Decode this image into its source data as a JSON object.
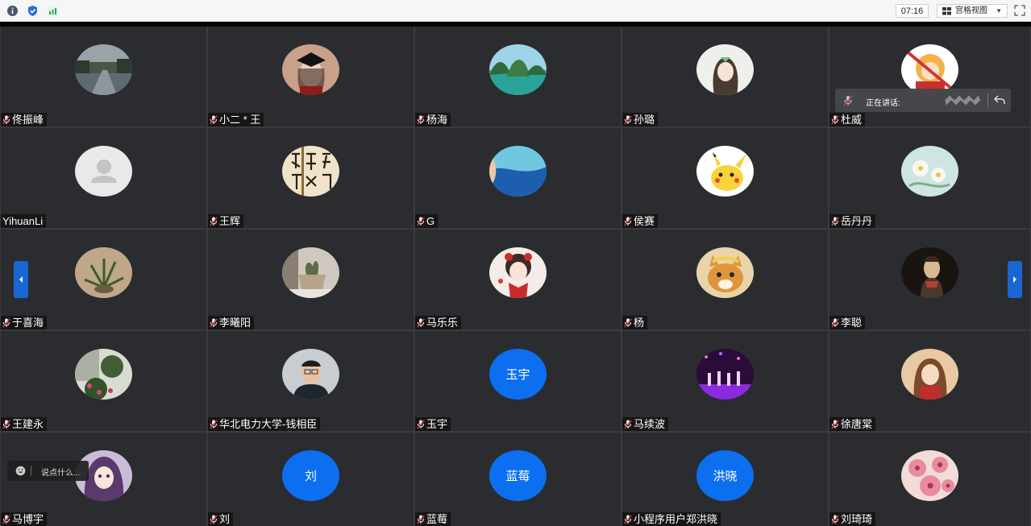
{
  "toolbar": {
    "icons": [
      "info-icon",
      "shield-icon",
      "signal-icon"
    ],
    "timer": "07:16",
    "view_mode": "宫格视图",
    "colors": {
      "info": "#4a5568",
      "shield": "#2b6fd6",
      "signal": "#29a745"
    }
  },
  "speaking": {
    "label": "正在讲话:"
  },
  "chat": {
    "placeholder": "说点什么..."
  },
  "participants": [
    {
      "name": "佟振峰",
      "muted": true,
      "avatar": "photo-river"
    },
    {
      "name": "小二 * 王",
      "muted": true,
      "avatar": "photo-graduate"
    },
    {
      "name": "杨海",
      "muted": true,
      "avatar": "photo-islands"
    },
    {
      "name": "孙璐",
      "muted": true,
      "avatar": "photo-girl-sketch"
    },
    {
      "name": "杜威",
      "muted": true,
      "avatar": "photo-cartoon-monkey"
    },
    {
      "name": "YihuanLi",
      "muted": false,
      "avatar": "default-user"
    },
    {
      "name": "王辉",
      "muted": true,
      "avatar": "photo-calligraphy"
    },
    {
      "name": "G",
      "muted": true,
      "avatar": "photo-sea"
    },
    {
      "name": "侯赛",
      "muted": true,
      "avatar": "photo-pikachu"
    },
    {
      "name": "岳丹丹",
      "muted": true,
      "avatar": "photo-flowers-pale"
    },
    {
      "name": "于喜海",
      "muted": true,
      "avatar": "photo-plant"
    },
    {
      "name": "李曦阳",
      "muted": true,
      "avatar": "photo-pot"
    },
    {
      "name": "马乐乐",
      "muted": true,
      "avatar": "photo-girl-red"
    },
    {
      "name": "杨",
      "muted": true,
      "avatar": "photo-cat"
    },
    {
      "name": "李聪",
      "muted": true,
      "avatar": "photo-painting"
    },
    {
      "name": "王建永",
      "muted": true,
      "avatar": "photo-garden"
    },
    {
      "name": "华北电力大学-钱相臣",
      "muted": true,
      "avatar": "photo-man"
    },
    {
      "name": "玉宇",
      "muted": true,
      "avatar": "text",
      "avatar_text": "玉宇"
    },
    {
      "name": "马续波",
      "muted": true,
      "avatar": "photo-stage"
    },
    {
      "name": "徐唐棠",
      "muted": true,
      "avatar": "photo-drawing"
    },
    {
      "name": "马博宇",
      "muted": true,
      "avatar": "photo-anime"
    },
    {
      "name": "刘",
      "muted": true,
      "avatar": "text",
      "avatar_text": "刘"
    },
    {
      "name": "蓝莓",
      "muted": true,
      "avatar": "text",
      "avatar_text": "蓝莓"
    },
    {
      "name": "小程序用户郑洪晓",
      "muted": true,
      "avatar": "text",
      "avatar_text": "洪晓"
    },
    {
      "name": "刘琦琦",
      "muted": true,
      "avatar": "photo-pink-flowers"
    }
  ]
}
